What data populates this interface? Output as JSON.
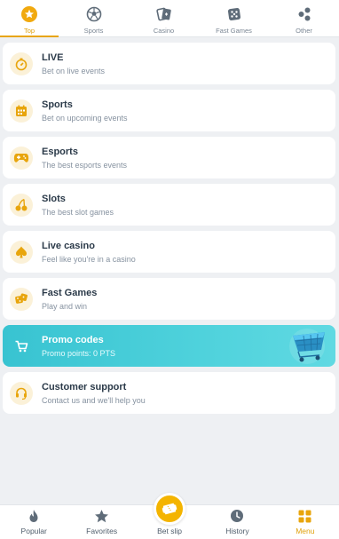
{
  "top_tabs": [
    {
      "label": "Top",
      "icon": "star-icon",
      "active": true
    },
    {
      "label": "Sports",
      "icon": "sports-ball-icon",
      "active": false
    },
    {
      "label": "Casino",
      "icon": "cards-icon",
      "active": false
    },
    {
      "label": "Fast Games",
      "icon": "dice-icon",
      "active": false
    },
    {
      "label": "Other",
      "icon": "dots-icon",
      "active": false
    }
  ],
  "menu": [
    {
      "title": "LIVE",
      "subtitle": "Bet on live events",
      "icon": "stopwatch-icon"
    },
    {
      "title": "Sports",
      "subtitle": "Bet on upcoming events",
      "icon": "calendar-icon"
    },
    {
      "title": "Esports",
      "subtitle": "The best esports events",
      "icon": "gamepad-icon"
    },
    {
      "title": "Slots",
      "subtitle": "The best slot games",
      "icon": "cherries-icon"
    },
    {
      "title": "Live casino",
      "subtitle": "Feel like you're in a casino",
      "icon": "spade-icon"
    },
    {
      "title": "Fast Games",
      "subtitle": "Play and win",
      "icon": "dice-icon"
    },
    {
      "title": "Promo codes",
      "subtitle": "Promo points: 0 PTS",
      "icon": "cart-icon"
    },
    {
      "title": "Customer support",
      "subtitle": "Contact us and we'll help you",
      "icon": "headset-icon"
    }
  ],
  "bottom_nav": [
    {
      "label": "Popular",
      "icon": "flame-icon",
      "active": false
    },
    {
      "label": "Favorites",
      "icon": "star-icon",
      "active": false
    },
    {
      "label": "Bet slip",
      "icon": "ticket-icon",
      "active": false
    },
    {
      "label": "History",
      "icon": "clock-icon",
      "active": false
    },
    {
      "label": "Menu",
      "icon": "grid-icon",
      "active": true
    }
  ],
  "colors": {
    "accent": "#e8a50c",
    "promo": "#45c8d5",
    "background": "#eef0f3"
  }
}
